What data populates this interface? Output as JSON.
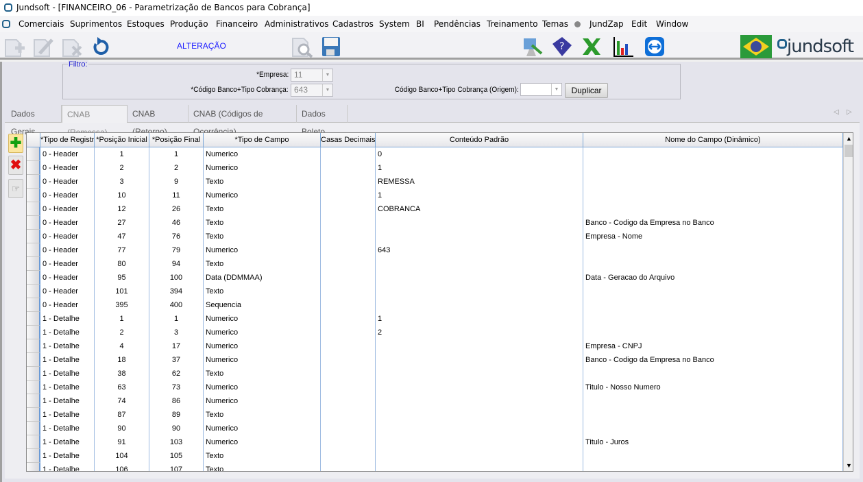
{
  "window": {
    "title": "Jundsoft - [FINANCEIRO_06 - Parametrização de Bancos para Cobrança]"
  },
  "menu": [
    "Comerciais",
    "Suprimentos",
    "Estoques",
    "Produção",
    "Financeiro",
    "Administrativos",
    "Cadastros",
    "System",
    "BI",
    "Pendências",
    "Treinamento",
    "Temas",
    "JundZap",
    "Edit",
    "Window"
  ],
  "toolbar": {
    "mode": "ALTERAÇÃO",
    "brand": "jundsoft"
  },
  "filter": {
    "legend": "Filtro:",
    "empresa_label": "*Empresa:",
    "empresa_value": "11",
    "codigo_label": "*Código Banco+Tipo Cobrança:",
    "codigo_value": "643",
    "origem_label": "Código Banco+Tipo Cobrança (Origem):",
    "origem_value": "",
    "duplicar": "Duplicar"
  },
  "tabs": [
    {
      "label": "Dados Gerais"
    },
    {
      "label": "CNAB (Remessa)",
      "active": true
    },
    {
      "label": "CNAB (Retorno)"
    },
    {
      "label": "CNAB (Códigos de Ocorrência)"
    },
    {
      "label": "Dados Boleto"
    }
  ],
  "grid": {
    "columns": [
      "*Tipo de Registro",
      "*Posição Inicial",
      "*Posição Final",
      "*Tipo de Campo",
      "Casas Decimais",
      "Conteúdo Padrão",
      "Nome do Campo (Dinâmico)"
    ],
    "rows": [
      [
        "0 - Header",
        "1",
        "1",
        "Numerico",
        "",
        "0",
        ""
      ],
      [
        "0 - Header",
        "2",
        "2",
        "Numerico",
        "",
        "1",
        ""
      ],
      [
        "0 - Header",
        "3",
        "9",
        "Texto",
        "",
        "REMESSA",
        ""
      ],
      [
        "0 - Header",
        "10",
        "11",
        "Numerico",
        "",
        "1",
        ""
      ],
      [
        "0 - Header",
        "12",
        "26",
        "Texto",
        "",
        "COBRANCA",
        ""
      ],
      [
        "0 - Header",
        "27",
        "46",
        "Texto",
        "",
        "",
        "Banco - Codigo da Empresa no Banco"
      ],
      [
        "0 - Header",
        "47",
        "76",
        "Texto",
        "",
        "",
        "Empresa - Nome"
      ],
      [
        "0 - Header",
        "77",
        "79",
        "Numerico",
        "",
        "643",
        ""
      ],
      [
        "0 - Header",
        "80",
        "94",
        "Texto",
        "",
        "",
        ""
      ],
      [
        "0 - Header",
        "95",
        "100",
        "Data (DDMMAA)",
        "",
        "",
        "Data - Geracao do Arquivo"
      ],
      [
        "0 - Header",
        "101",
        "394",
        "Texto",
        "",
        "",
        ""
      ],
      [
        "0 - Header",
        "395",
        "400",
        "Sequencia",
        "",
        "",
        ""
      ],
      [
        "1 - Detalhe",
        "1",
        "1",
        "Numerico",
        "",
        "1",
        ""
      ],
      [
        "1 - Detalhe",
        "2",
        "3",
        "Numerico",
        "",
        "2",
        ""
      ],
      [
        "1 - Detalhe",
        "4",
        "17",
        "Numerico",
        "",
        "",
        "Empresa - CNPJ"
      ],
      [
        "1 - Detalhe",
        "18",
        "37",
        "Numerico",
        "",
        "",
        "Banco - Codigo da Empresa no Banco"
      ],
      [
        "1 - Detalhe",
        "38",
        "62",
        "Texto",
        "",
        "",
        ""
      ],
      [
        "1 - Detalhe",
        "63",
        "73",
        "Numerico",
        "",
        "",
        "Titulo - Nosso Numero"
      ],
      [
        "1 - Detalhe",
        "74",
        "86",
        "Numerico",
        "",
        "",
        ""
      ],
      [
        "1 - Detalhe",
        "87",
        "89",
        "Texto",
        "",
        "",
        ""
      ],
      [
        "1 - Detalhe",
        "90",
        "90",
        "Numerico",
        "",
        "",
        ""
      ],
      [
        "1 - Detalhe",
        "91",
        "103",
        "Numerico",
        "",
        "",
        "Titulo - Juros"
      ],
      [
        "1 - Detalhe",
        "104",
        "105",
        "Texto",
        "",
        "",
        ""
      ],
      [
        "1 - Detalhe",
        "106",
        "107",
        "Texto",
        "",
        "",
        ""
      ]
    ]
  },
  "colors": {
    "accent": "#2020ff",
    "grid_line": "#9ab8e0"
  }
}
